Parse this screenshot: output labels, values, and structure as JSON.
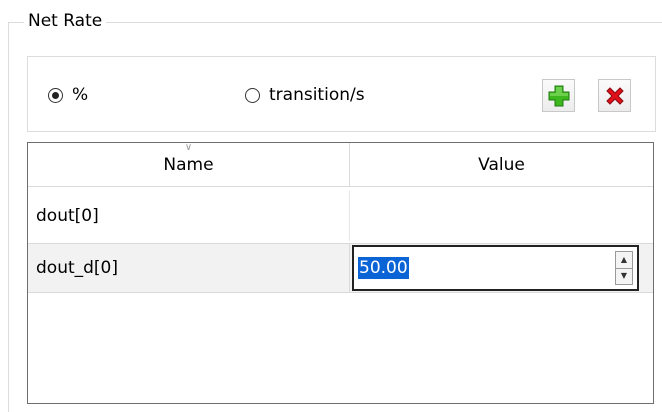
{
  "group": {
    "title": "Net Rate"
  },
  "mode": {
    "options": [
      {
        "label": "%",
        "selected": true
      },
      {
        "label": "transition/s",
        "selected": false
      }
    ]
  },
  "toolbar": {
    "add_icon": "green-plus-icon",
    "remove_icon": "red-x-icon",
    "colors": {
      "add": "#3cb81e",
      "remove": "#e0111b",
      "selection": "#0a64d6"
    }
  },
  "table": {
    "columns": [
      "Name",
      "Value"
    ],
    "rows": [
      {
        "name": "dout[0]",
        "value": ""
      },
      {
        "name": "dout_d[0]",
        "value": "50.00",
        "editing": true
      }
    ]
  }
}
